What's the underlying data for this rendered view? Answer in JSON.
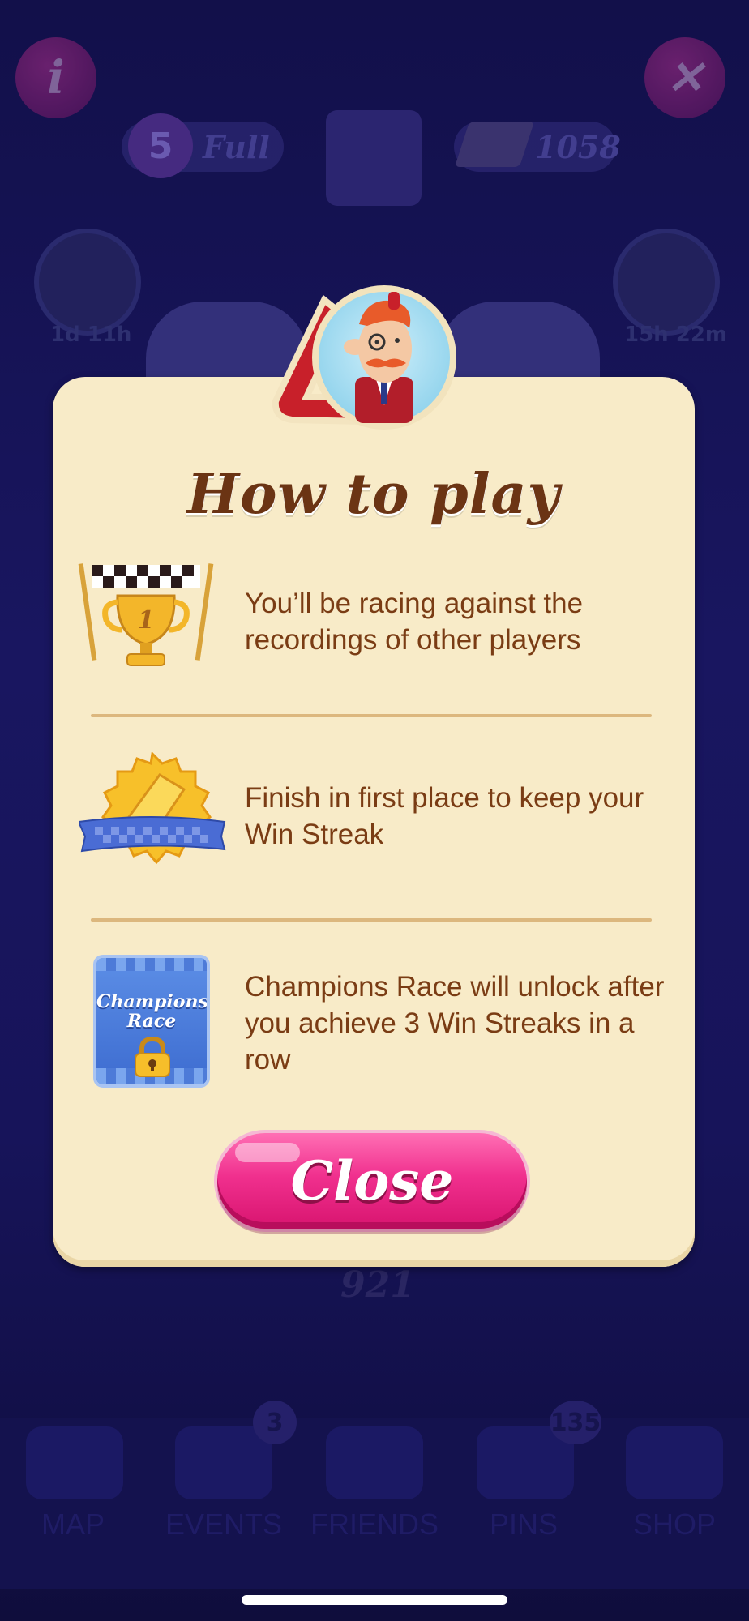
{
  "background": {
    "lives": {
      "count": "5",
      "status": "Full"
    },
    "gold_bars": "1058",
    "left_timer": "1d 11h",
    "right_timer": "15h 22m",
    "level_number": "921",
    "nav": [
      {
        "label": "MAP",
        "badge": ""
      },
      {
        "label": "EVENTS",
        "badge": "3"
      },
      {
        "label": "FRIENDS",
        "badge": ""
      },
      {
        "label": "PINS",
        "badge": "135"
      },
      {
        "label": "SHOP",
        "badge": ""
      }
    ]
  },
  "modal": {
    "title": "How to play",
    "rows": [
      {
        "icon": "trophy-icon",
        "text": "You’ll be racing against the recordings of other players"
      },
      {
        "icon": "gold-bar-badge-icon",
        "text": "Finish in first place to keep your Win Streak"
      },
      {
        "icon": "champions-race-locked-icon",
        "text": "Champions Race will unlock after you achieve 3 Win Streaks in a row",
        "icon_label": "Champions Race"
      }
    ],
    "close_label": "Close"
  },
  "colors": {
    "panel": "#f8ebc8",
    "title": "#6b3414",
    "text": "#7a3c14",
    "close_button": "#f0308e",
    "backdrop": "#14124a"
  }
}
